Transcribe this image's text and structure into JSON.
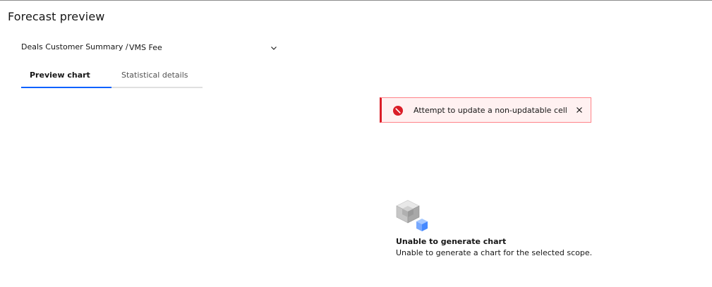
{
  "page": {
    "title": "Forecast preview"
  },
  "scope": {
    "path_label": "Deals Customer Summary /",
    "selected_value": "VMS Fee"
  },
  "tabs": [
    {
      "label": "Preview chart",
      "selected": true
    },
    {
      "label": "Statistical details",
      "selected": false
    }
  ],
  "notification": {
    "kind": "error",
    "message": "Attempt to update a non-updatable cell",
    "accent_color": "#da1e28"
  },
  "empty_state": {
    "title": "Unable to generate chart",
    "description": "Unable to generate a chart for the selected scope."
  },
  "colors": {
    "tab_active_border": "#0f62fe",
    "error": "#da1e28",
    "error_bg": "#fff1f1"
  }
}
